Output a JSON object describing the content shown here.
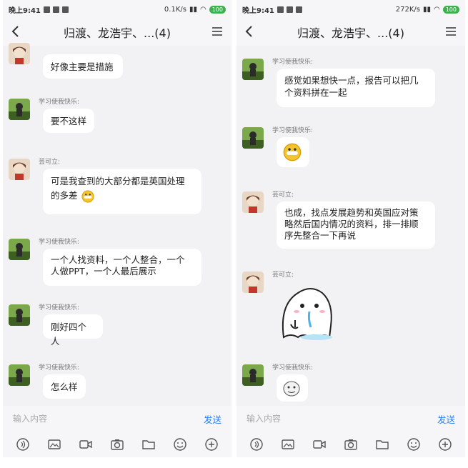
{
  "phones": [
    {
      "status": {
        "time": "晚上9:41",
        "speed": "0.1K/s",
        "battery": "100"
      },
      "header": {
        "title": "归渡、龙浩宇、...(4)"
      },
      "messages": [
        {
          "sender": "",
          "text": "好像主要是措施",
          "avatar": "girl"
        },
        {
          "sender": "学习使我快乐:",
          "text": "要不这样",
          "avatar": "green"
        },
        {
          "sender": "芸可立:",
          "text": "可是我查到的大部分都是英国处理",
          "text2": "的多差",
          "avatar": "girl"
        },
        {
          "sender": "学习使我快乐:",
          "text": "一个人找资料，一个人整合，一个",
          "text2": "人做PPT，一个人最后展示",
          "avatar": "green"
        },
        {
          "sender": "学习使我快乐:",
          "text": "刚好四个人",
          "avatar": "green"
        },
        {
          "sender": "学习使我快乐:",
          "text": "怎么样",
          "avatar": "green"
        }
      ],
      "input": {
        "placeholder": "输入内容",
        "send_label": "发送"
      }
    },
    {
      "status": {
        "time": "晚上9:41",
        "speed": "272K/s",
        "battery": "100"
      },
      "header": {
        "title": "归渡、龙浩宇、...(4)"
      },
      "messages": [
        {
          "sender": "学习使我快乐:",
          "text": "感觉如果想快一点，报告可以把几",
          "text2": "个资料拼在一起",
          "avatar": "green"
        },
        {
          "sender": "学习使我快乐:",
          "sticker": "grin-emoji",
          "avatar": "green"
        },
        {
          "sender": "芸可立:",
          "text": "也成，找点发展趋势和英国应对策",
          "text2": "略然后国内情况的资料，排一排顺",
          "text3": "序先整合一下再说",
          "avatar": "girl"
        },
        {
          "sender": "芸可立:",
          "sticker": "ghost-sticker",
          "avatar": "girl"
        },
        {
          "sender": "学习使我快乐:",
          "sticker": "small-sticker",
          "avatar": "green"
        }
      ],
      "input": {
        "placeholder": "输入内容",
        "send_label": "发送"
      }
    }
  ],
  "toolbar_icons": [
    "voice-icon",
    "image-icon",
    "video-icon",
    "camera-icon",
    "folder-icon",
    "emoji-icon",
    "plus-icon"
  ],
  "colors": {
    "accent": "#2b7ff2",
    "background": "#f2f2f5",
    "bubble": "#ffffff"
  }
}
